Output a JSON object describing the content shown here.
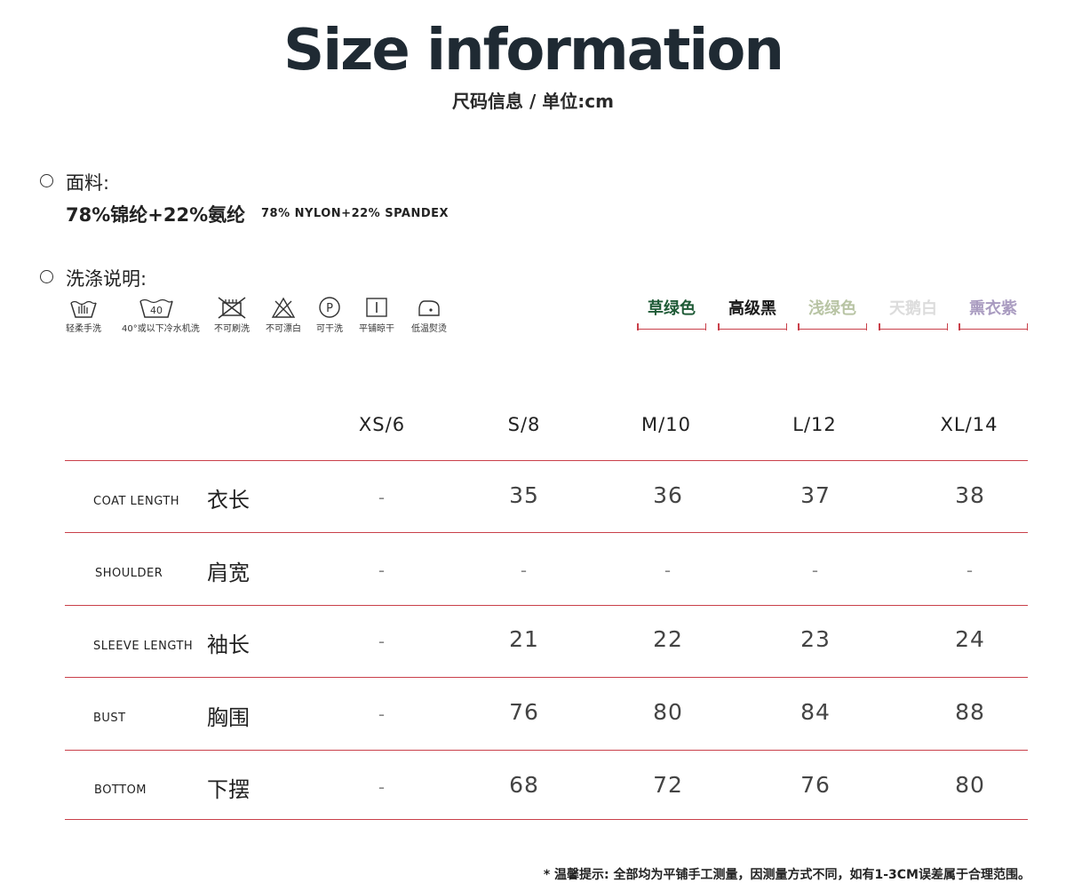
{
  "header": {
    "title": "Size information",
    "subtitle": "尺码信息 / 单位:cm"
  },
  "fabric": {
    "label": "面料:",
    "composition_cn": "78%锦纶+22%氨纶",
    "composition_en": "78% NYLON+22% SPANDEX"
  },
  "care": {
    "label": "洗涤说明:",
    "items": [
      {
        "icon": "hand-wash-icon",
        "label": "轻柔手洗"
      },
      {
        "icon": "machine-wash-40-icon",
        "label": "40°或以下冷水机洗",
        "badge": "40"
      },
      {
        "icon": "no-brush-icon",
        "label": "不可刷洗"
      },
      {
        "icon": "no-bleach-icon",
        "label": "不可漂白"
      },
      {
        "icon": "dry-clean-p-icon",
        "label": "可干洗",
        "badge": "P"
      },
      {
        "icon": "dry-flat-icon",
        "label": "平铺晾干"
      },
      {
        "icon": "iron-low-icon",
        "label": "低温熨烫"
      }
    ]
  },
  "colors": [
    {
      "name": "草绿色",
      "color": "#1e5a36"
    },
    {
      "name": "高级黑",
      "color": "#1a1a1a"
    },
    {
      "name": "浅绿色",
      "color": "#b8c4a4"
    },
    {
      "name": "天鹅白",
      "color": "#dcdcdc"
    },
    {
      "name": "熏衣紫",
      "color": "#a99bc0"
    }
  ],
  "size_table": {
    "sizes": [
      "XS/6",
      "S/8",
      "M/10",
      "L/12",
      "XL/14"
    ],
    "rows": [
      {
        "en": "COAT LENGTH",
        "cn": "衣长",
        "values": [
          "-",
          "35",
          "36",
          "37",
          "38"
        ]
      },
      {
        "en": "SHOULDER",
        "cn": "肩宽",
        "values": [
          "-",
          "-",
          "-",
          "-",
          "-"
        ]
      },
      {
        "en": "SLEEVE LENGTH",
        "cn": "袖长",
        "values": [
          "-",
          "21",
          "22",
          "23",
          "24"
        ]
      },
      {
        "en": "BUST",
        "cn": "胸围",
        "values": [
          "-",
          "76",
          "80",
          "84",
          "88"
        ]
      },
      {
        "en": "BOTTOM",
        "cn": "下摆",
        "values": [
          "-",
          "68",
          "72",
          "76",
          "80"
        ]
      }
    ]
  },
  "footnote": "* 温馨提示: 全部均为平铺手工测量，因测量方式不同，如有1-3CM误差属于合理范围。",
  "accent_color": "#c9404a"
}
